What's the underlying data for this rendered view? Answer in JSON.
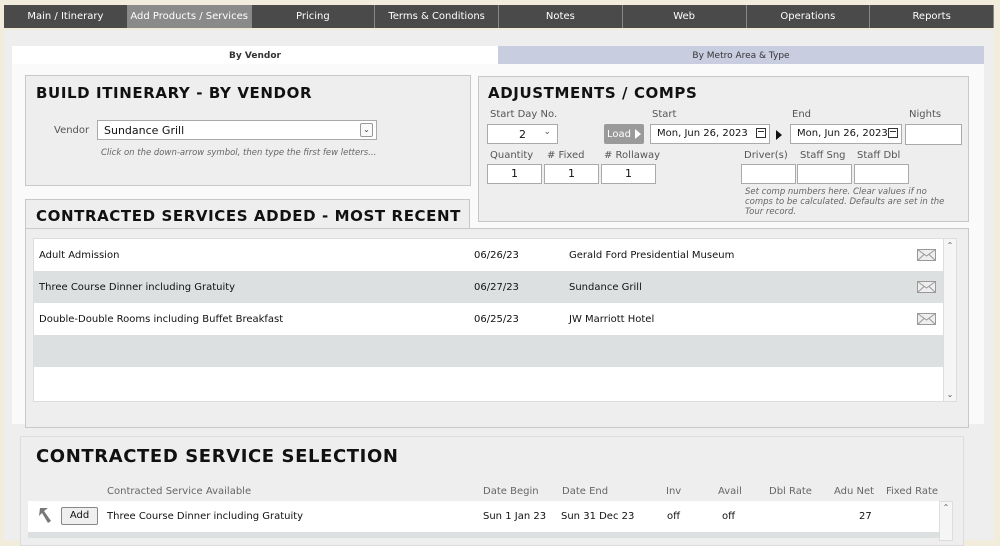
{
  "nav": {
    "tabs": [
      "Main / Itinerary",
      "Add Products / Services",
      "Pricing",
      "Terms & Conditions",
      "Notes",
      "Web",
      "Operations",
      "Reports"
    ],
    "active": "Add Products / Services"
  },
  "subtabs": {
    "by_vendor": "By Vendor",
    "by_metro": "By Metro Area & Type"
  },
  "build": {
    "title": "BUILD ITINERARY - BY VENDOR",
    "vendor_label": "Vendor",
    "vendor_value": "Sundance Grill",
    "hint": "Click on the down-arrow symbol, then type the first few letters..."
  },
  "adjust": {
    "title": "ADJUSTMENTS / COMPS",
    "start_day_label": "Start Day No.",
    "start_day_value": "2",
    "load_label": "Load",
    "start_label": "Start",
    "start_value": "Mon, Jun 26, 2023",
    "end_label": "End",
    "end_value": "Mon, Jun 26, 2023",
    "nights_label": "Nights",
    "nights_value": "",
    "quantity_label": "Quantity",
    "quantity_value": "1",
    "fixed_label": "# Fixed",
    "fixed_value": "1",
    "rollaway_label": "# Rollaway",
    "rollaway_value": "1",
    "drivers_label": "Driver(s)",
    "staff_sng_label": "Staff Sng",
    "staff_dbl_label": "Staff Dbl",
    "hint": "Set comp numbers here. Clear values if no comps to be calculated. Defaults are set in the Tour record."
  },
  "recent": {
    "title": "CONTRACTED SERVICES ADDED - MOST RECENT",
    "rows": [
      {
        "service": "Adult Admission",
        "date": "06/26/23",
        "vendor": "Gerald Ford Presidential Museum"
      },
      {
        "service": "Three Course Dinner including Gratuity",
        "date": "06/27/23",
        "vendor": "Sundance Grill"
      },
      {
        "service": "Double-Double Rooms including Buffet Breakfast",
        "date": "06/25/23",
        "vendor": "JW Marriott Hotel"
      }
    ]
  },
  "selection": {
    "title": "CONTRACTED SERVICE SELECTION",
    "columns": {
      "service": "Contracted Service Available",
      "date_begin": "Date Begin",
      "date_end": "Date End",
      "inv": "Inv",
      "avail": "Avail",
      "dbl_rate": "Dbl Rate",
      "adu_net": "Adu Net",
      "fixed_rate": "Fixed Rate"
    },
    "add_label": "Add",
    "rows": [
      {
        "service": "Three Course Dinner including Gratuity",
        "date_begin": "Sun 1 Jan 23",
        "date_end": "Sun 31 Dec 23",
        "inv": "off",
        "avail": "off",
        "dbl_rate": "",
        "adu_net": "27",
        "fixed_rate": ""
      }
    ]
  }
}
